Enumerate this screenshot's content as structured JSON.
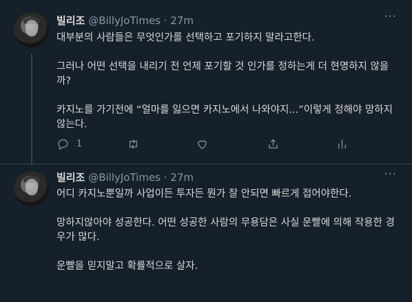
{
  "tweets": [
    {
      "name": "빌리조",
      "handle": "@BillyJoTimes",
      "sep": "·",
      "time": "27m",
      "paragraphs": [
        "대부분의 사람들은 무엇인가를 선택하고 포기하지 말라고한다.",
        "그러나 어떤 선택을 내리기 전 언제 포기할 것 인가를 정하는게 더 현명하지 않을까?",
        "카지노를 가기전에 “얼마를 잃으면 카지노에서 나와야지...”이렇게 정해야 망하지 않는다."
      ],
      "reply_count": "1",
      "icons": [
        "reply-icon",
        "retweet-icon",
        "like-icon",
        "share-icon",
        "analytics-icon"
      ]
    },
    {
      "name": "빌리조",
      "handle": "@BillyJoTimes",
      "sep": "·",
      "time": "27m",
      "paragraphs": [
        "어디 카지노뿐일까 사업이든 투자든 뭔가 잘 안되면 빠르게 접어야한다.",
        "망하지않아야 성공한다. 어떤 성공한 사람의 무용담은 사실 운빨에 의해 작용한 경우가 많다.",
        "운빨을 믿지말고 확률적으로 살자."
      ]
    }
  ],
  "more_label": "···",
  "colors": {
    "background": "#15202b",
    "text": "#d9d9d9",
    "secondary": "#8899a6",
    "divider": "#38444d"
  }
}
